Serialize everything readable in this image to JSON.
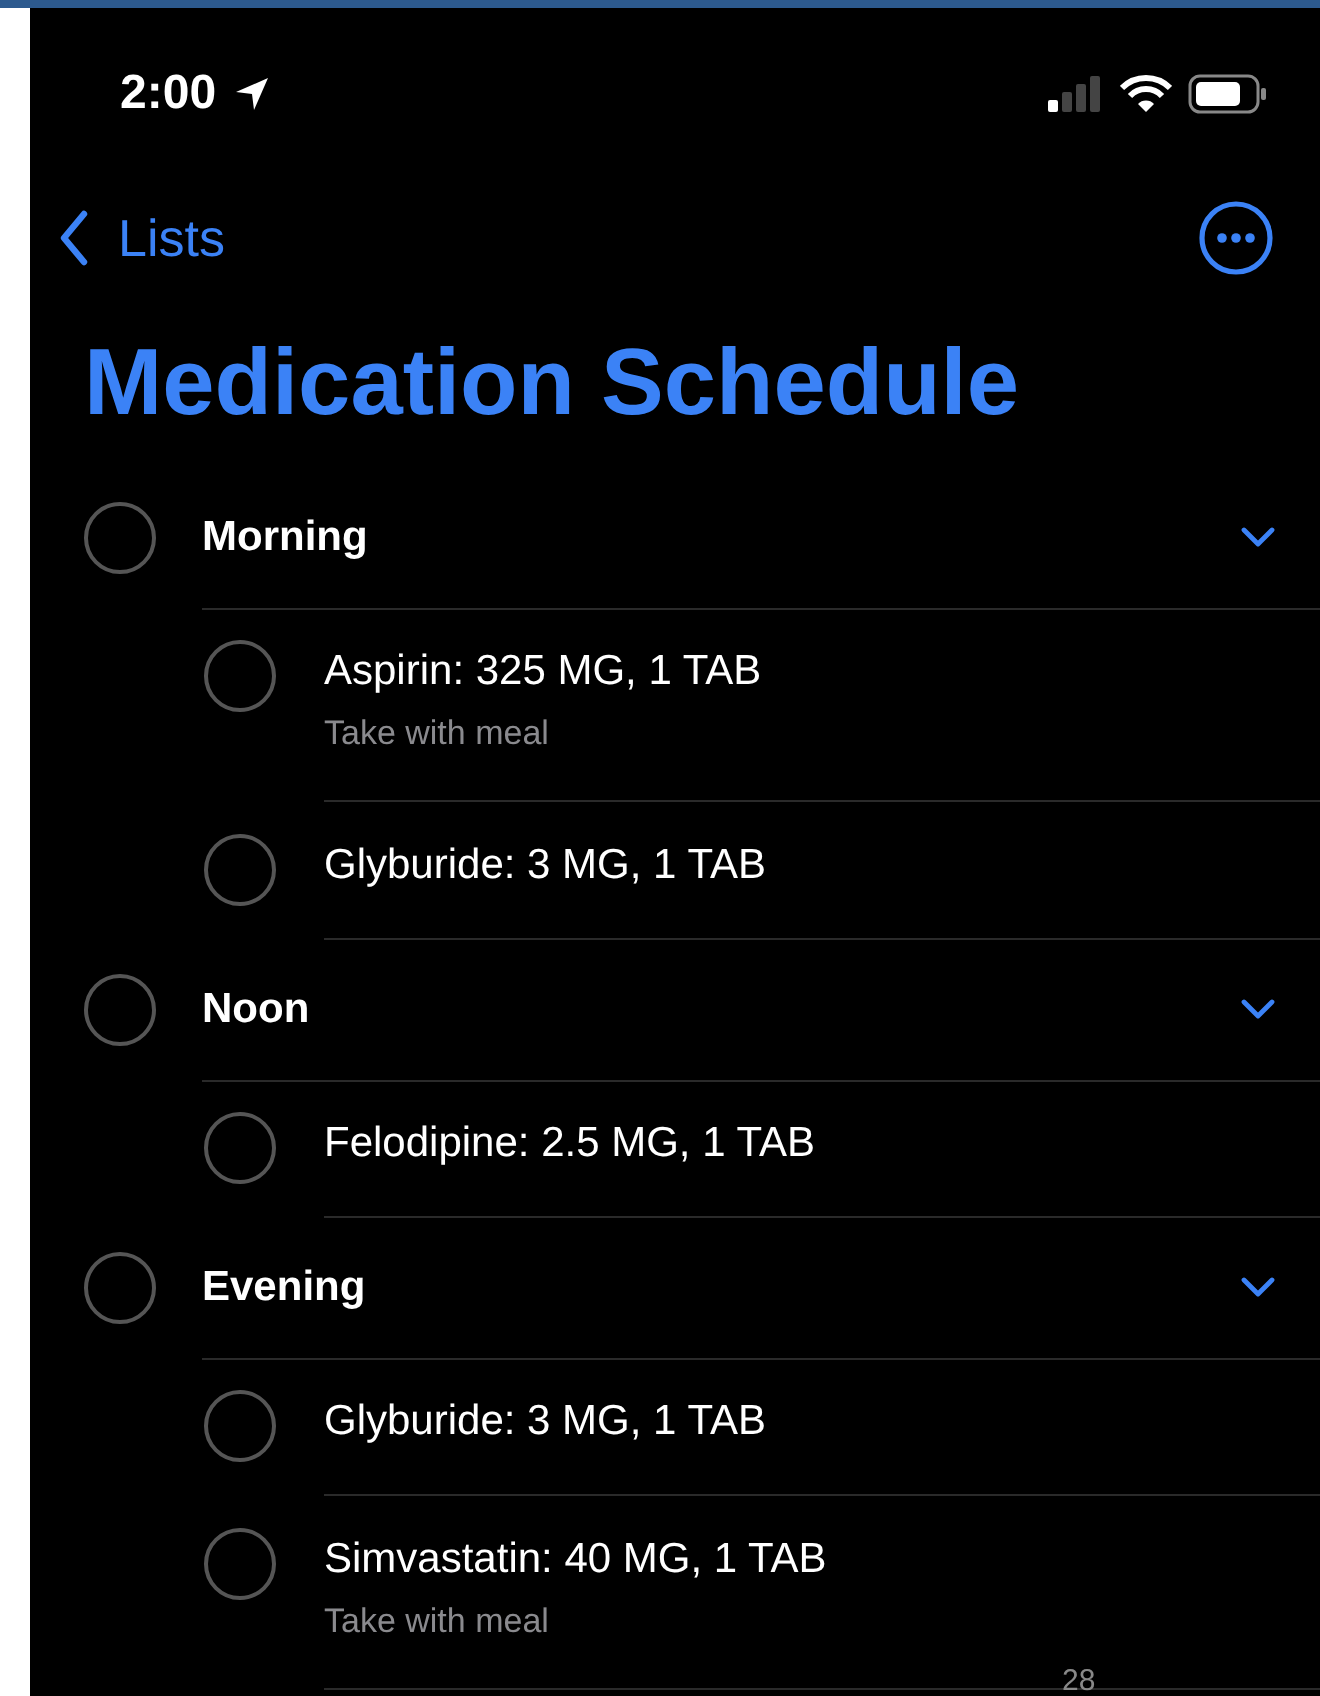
{
  "status_bar": {
    "time": "2:00"
  },
  "nav": {
    "back_label": "Lists"
  },
  "title": "Medication Schedule",
  "groups": [
    {
      "title": "Morning",
      "checked": false,
      "expanded": true,
      "items": [
        {
          "title": "Aspirin: 325 MG, 1 TAB",
          "note": "Take with meal",
          "checked": false
        },
        {
          "title": "Glyburide: 3 MG, 1 TAB",
          "checked": false
        }
      ]
    },
    {
      "title": "Noon",
      "checked": false,
      "expanded": true,
      "items": [
        {
          "title": "Felodipine: 2.5 MG, 1 TAB",
          "checked": false
        }
      ]
    },
    {
      "title": "Evening",
      "checked": false,
      "expanded": true,
      "items": [
        {
          "title": "Glyburide: 3 MG, 1 TAB",
          "checked": false
        },
        {
          "title": "Simvastatin: 40 MG, 1 TAB",
          "note": "Take with meal",
          "checked": false
        }
      ]
    }
  ],
  "page_number": "28"
}
